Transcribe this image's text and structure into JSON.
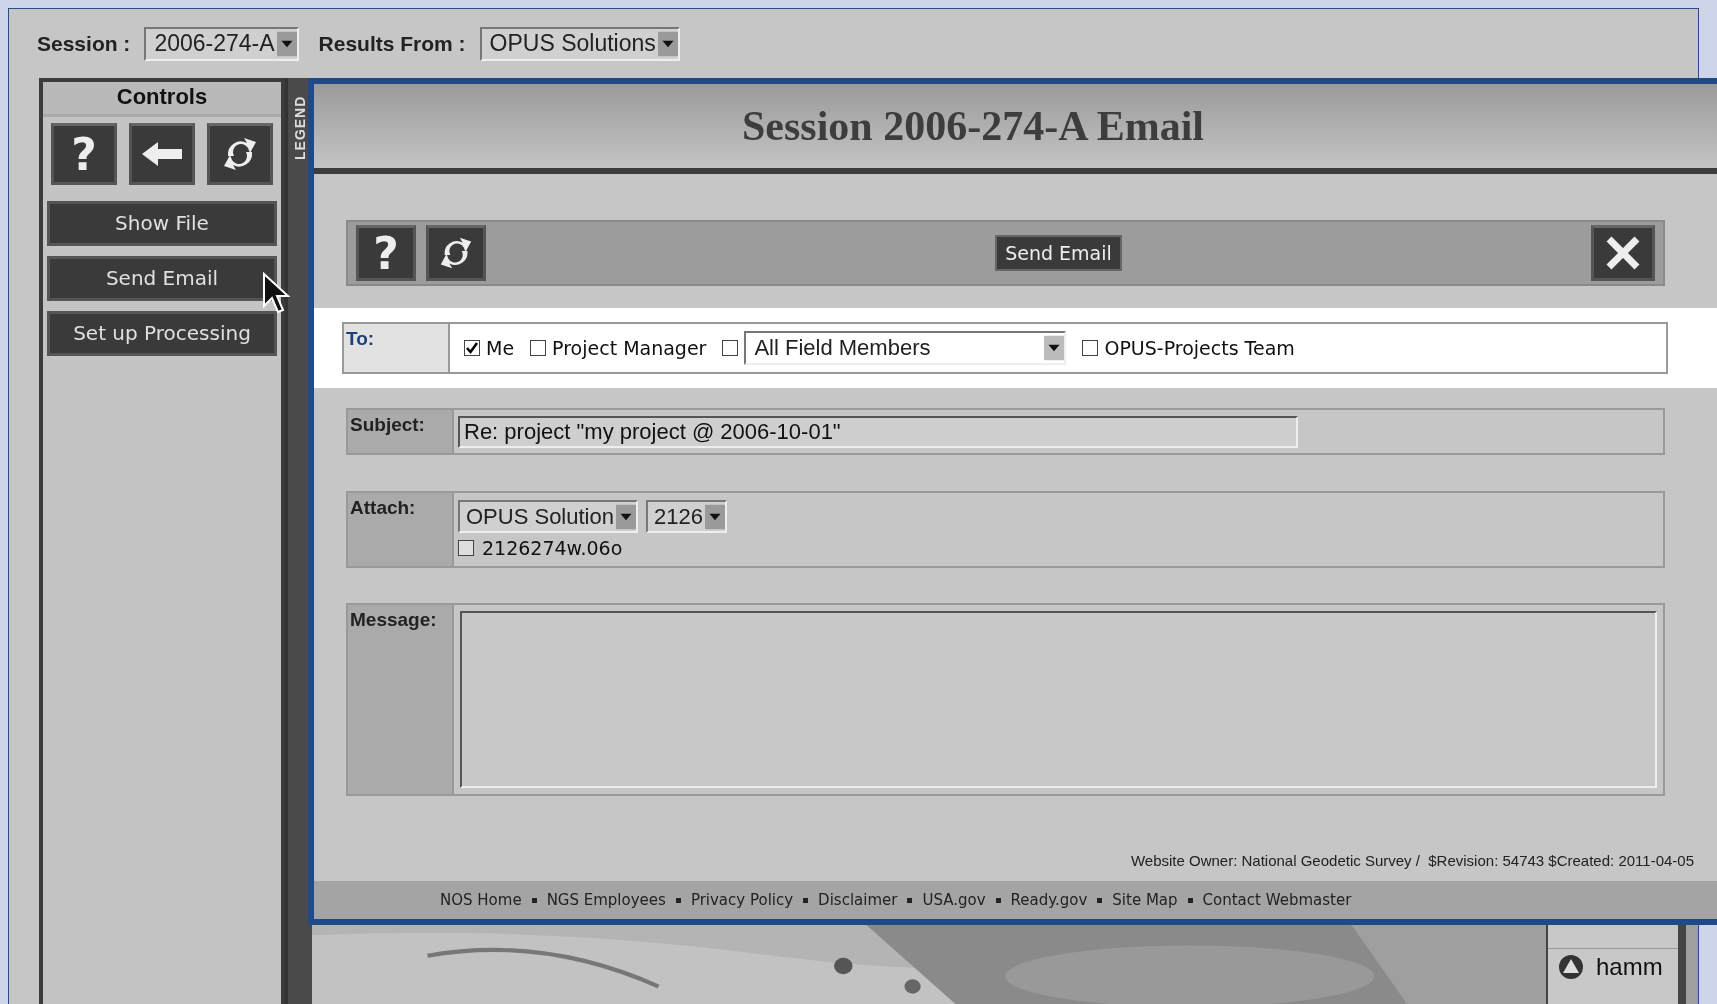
{
  "session": {
    "label": "Session :",
    "value": "2006-274-A"
  },
  "results_from": {
    "label": "Results From :",
    "value": "OPUS Solutions"
  },
  "controls": {
    "title": "Controls",
    "icon_buttons": [
      {
        "kind": "help",
        "label": "?"
      },
      {
        "kind": "back"
      },
      {
        "kind": "refresh"
      }
    ],
    "buttons": [
      "Show File",
      "Send Email",
      "Set up Processing"
    ]
  },
  "legend": {
    "title": "LEGEND",
    "items": [
      "hamm"
    ]
  },
  "dialog": {
    "title": "Session 2006-274-A Email",
    "toolbar": {
      "help": "?",
      "send_button": "Send Email"
    },
    "to": {
      "label": "To:",
      "recipients": [
        {
          "kind": "checkbox",
          "label": "Me",
          "checked": true
        },
        {
          "kind": "checkbox",
          "label": "Project Manager",
          "checked": false
        },
        {
          "kind": "select",
          "checked": false,
          "value": "All Field Members"
        },
        {
          "kind": "checkbox",
          "label": "OPUS-Projects Team",
          "checked": false
        }
      ]
    },
    "subject": {
      "label": "Subject:",
      "value": "Re: project \"my project @ 2006-10-01\""
    },
    "attach": {
      "label": "Attach:",
      "selects": [
        "OPUS Solution",
        "2126"
      ],
      "files": [
        {
          "label": "2126274w.06o",
          "checked": false
        }
      ]
    },
    "message": {
      "label": "Message:"
    },
    "owner_line": "Website Owner: National Geodetic Survey /  $Revision: 54743 $Created: 2011-04-05",
    "footer_links": [
      "NOS Home",
      "NGS Employees",
      "Privacy Policy",
      "Disclaimer",
      "USA.gov",
      "Ready.gov",
      "Site Map",
      "Contact Webmaster"
    ]
  }
}
